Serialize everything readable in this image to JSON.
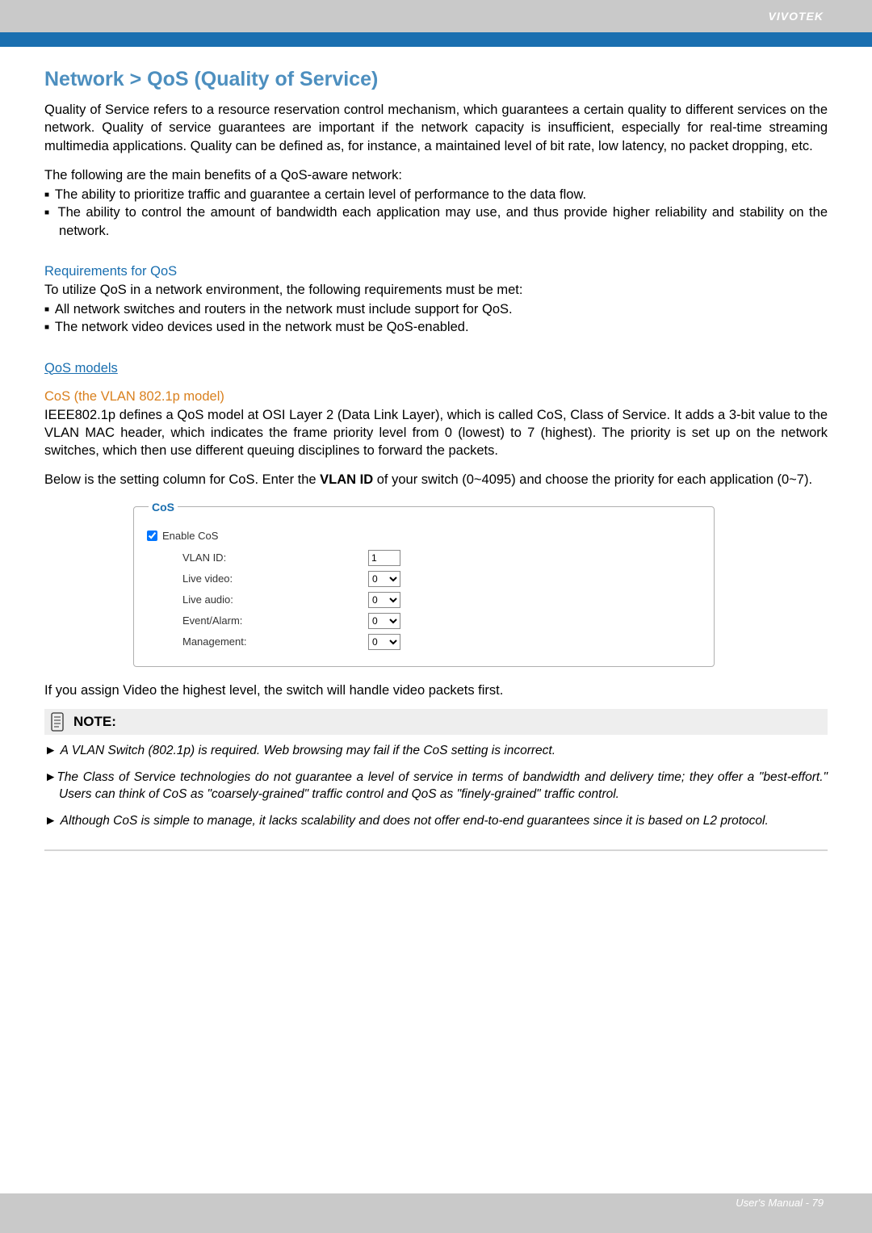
{
  "brand": "VIVOTEK",
  "title": "Network > QoS (Quality of Service)",
  "intro": "Quality of Service refers to a resource reservation control mechanism, which guarantees a certain quality to different services on the network. Quality of service guarantees are important if the network capacity is insufficient, especially for real-time streaming multimedia applications. Quality can be defined as, for instance, a maintained level of bit rate, low latency, no packet dropping, etc.",
  "benefits_lead": "The following are the main benefits of a QoS-aware network:",
  "benefits": [
    "The ability to prioritize traffic and guarantee a certain level of performance to the data flow.",
    "The ability to control the amount of bandwidth each application may use, and thus provide higher reliability and stability on the network."
  ],
  "req_heading": "Requirements for QoS",
  "req_lead": "To utilize QoS in a network environment, the following requirements must be met:",
  "req_items": [
    "All network switches and routers in the network must include support for QoS.",
    "The network video devices used in the network must be QoS-enabled."
  ],
  "models_heading": "QoS models",
  "cos_heading": "CoS (the VLAN 802.1p model)",
  "cos_para": "IEEE802.1p defines a QoS model at OSI Layer 2 (Data Link Layer), which is called CoS, Class of Service. It adds a 3-bit value to the VLAN MAC header, which indicates the frame priority level from 0 (lowest) to 7 (highest). The priority is set up on the network switches, which then use different queuing disciplines to forward the packets.",
  "cos_setting_lead_pre": "Below is the setting column for CoS. Enter the ",
  "cos_setting_bold": "VLAN ID",
  "cos_setting_lead_post": " of your switch (0~4095) and choose the priority for each application (0~7).",
  "cos_form": {
    "legend": "CoS",
    "enable_label": "Enable CoS",
    "enable_checked": true,
    "fields": {
      "vlan_id": {
        "label": "VLAN ID:",
        "value": "1"
      },
      "live_video": {
        "label": "Live video:",
        "value": "0"
      },
      "live_audio": {
        "label": "Live audio:",
        "value": "0"
      },
      "event_alarm": {
        "label": "Event/Alarm:",
        "value": "0"
      },
      "management": {
        "label": "Management:",
        "value": "0"
      }
    }
  },
  "after_form": "If you assign Video the highest level, the switch will handle video packets first.",
  "note_label": "NOTE:",
  "notes": [
    "A VLAN Switch (802.1p) is required. Web browsing may fail if the CoS setting is incorrect.",
    "The Class of Service technologies do not guarantee a level of service in terms of bandwidth and delivery time; they offer a \"best-effort.\" Users can think of CoS as \"coarsely-grained\" traffic control and QoS as \"finely-grained\" traffic control.",
    "Although CoS is simple to manage, it lacks scalability and does not offer end-to-end guarantees since it is based on L2 protocol."
  ],
  "footer": "User's Manual - 79"
}
